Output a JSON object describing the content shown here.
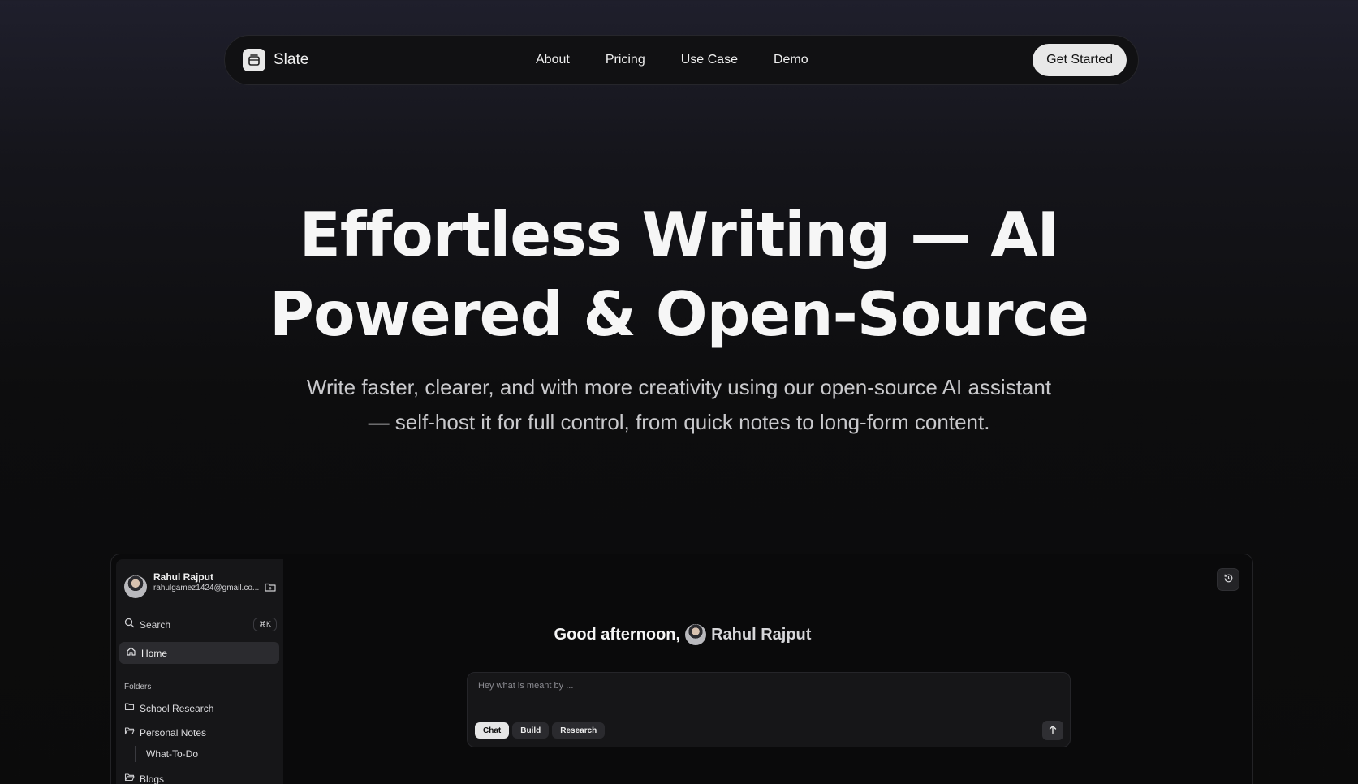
{
  "nav": {
    "brand": "Slate",
    "links": [
      "About",
      "Pricing",
      "Use Case",
      "Demo"
    ],
    "cta": "Get Started"
  },
  "hero": {
    "title_line1": "Effortless Writing — AI",
    "title_line2": "Powered & Open-Source",
    "subtitle_line1": "Write faster, clearer, and with more creativity using our open-source AI assistant",
    "subtitle_line2": "— self-host it for full control, from quick notes to long-form content."
  },
  "app": {
    "user": {
      "name": "Rahul Rajput",
      "email": "rahulgamez1424@gmail.co..."
    },
    "sidebar": {
      "search_label": "Search",
      "search_shortcut": "⌘K",
      "home_label": "Home",
      "folders_heading": "Folders",
      "folders": [
        "School Research",
        "Personal Notes",
        "Blogs"
      ],
      "sub_item": "What-To-Do"
    },
    "greeting_prefix": "Good afternoon,",
    "greeting_name": "Rahul Rajput",
    "chat": {
      "placeholder": "Hey what is meant by ...",
      "modes": [
        "Chat",
        "Build",
        "Research"
      ],
      "active_mode": "Chat"
    }
  }
}
